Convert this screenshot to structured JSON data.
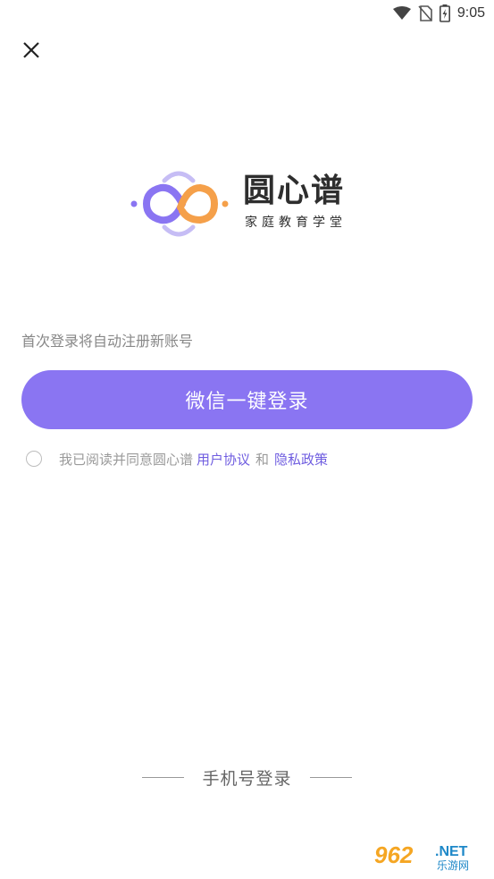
{
  "status_bar": {
    "time": "9:05",
    "icons": [
      "wifi-icon",
      "no-sim-icon",
      "battery-charging-icon"
    ]
  },
  "close": {
    "icon": "close-icon"
  },
  "logo": {
    "name": "圆心谱",
    "tagline": "家庭教育学堂",
    "colors": {
      "purple": "#8a75f2",
      "orange": "#f5a04a",
      "lavender": "#c6bdf5"
    }
  },
  "login": {
    "hint": "首次登录将自动注册新账号",
    "wechat_button": "微信一键登录",
    "button_color": "#8a75f2"
  },
  "agreement": {
    "text": "我已阅读并同意圆心谱",
    "user_agreement": "用户协议",
    "and": "和",
    "privacy_policy": "隐私政策",
    "checked": false
  },
  "alt_login": {
    "label": "手机号登录"
  },
  "watermark": {
    "main": "962",
    "suffix": ".NET",
    "sub": "乐游网"
  }
}
